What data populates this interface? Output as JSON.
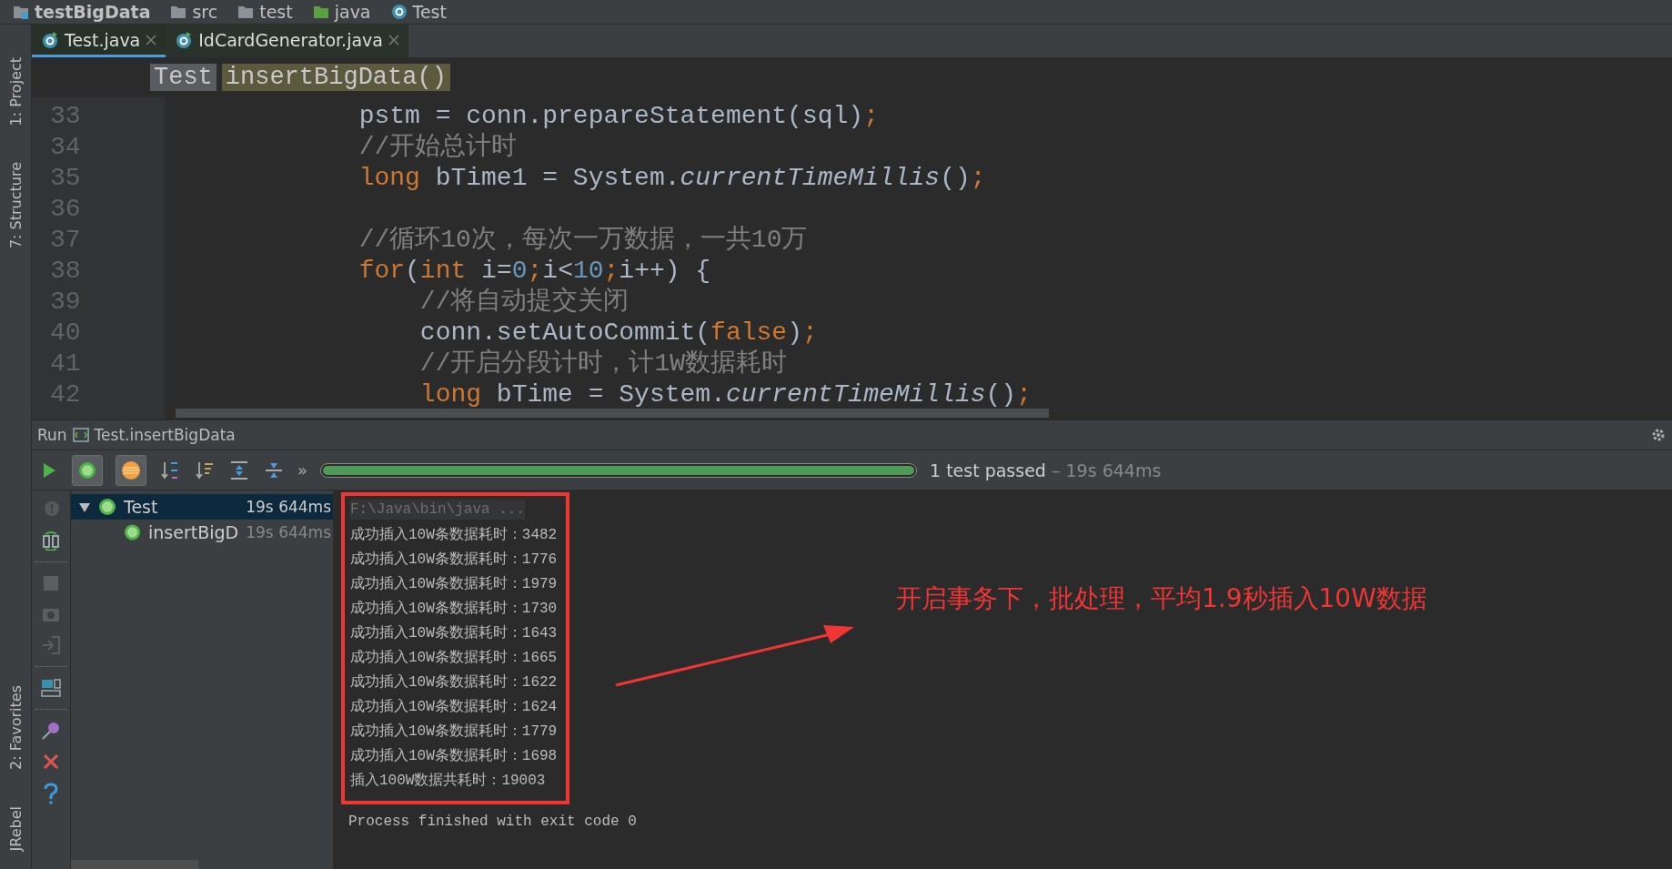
{
  "breadcrumbs": [
    {
      "label": "testBigData",
      "kind": "project"
    },
    {
      "label": "src",
      "kind": "folder"
    },
    {
      "label": "test",
      "kind": "folder"
    },
    {
      "label": "java",
      "kind": "source"
    },
    {
      "label": "Test",
      "kind": "class"
    }
  ],
  "side_tabs_top": [
    "1: Project",
    "7: Structure"
  ],
  "side_tabs_bottom": [
    "2: Favorites",
    "JRebel"
  ],
  "editor_tabs": [
    {
      "label": "Test.java",
      "selected": true
    },
    {
      "label": "IdCardGenerator.java",
      "selected": false
    }
  ],
  "editor_crumbs": [
    {
      "label": "Test",
      "kind": "class"
    },
    {
      "label": "insertBigData()",
      "kind": "method"
    }
  ],
  "code": [
    {
      "number": "33",
      "tokens": [
        {
          "kind": "plain",
          "text": "            pstm = conn.prepareStatement(sql)"
        },
        {
          "kind": "keyword",
          "text": ";"
        }
      ]
    },
    {
      "number": "34",
      "tokens": [
        {
          "kind": "comment",
          "text": "            //开始总计时"
        }
      ]
    },
    {
      "number": "35",
      "tokens": [
        {
          "kind": "keyword",
          "text": "            long"
        },
        {
          "kind": "plain",
          "text": " bTime1 = System."
        },
        {
          "kind": "italic",
          "text": "currentTimeMillis"
        },
        {
          "kind": "plain",
          "text": "()"
        },
        {
          "kind": "keyword",
          "text": ";"
        }
      ]
    },
    {
      "number": "36"
    },
    {
      "number": "37",
      "tokens": [
        {
          "kind": "comment",
          "text": "            //循环10次，每次一万数据，一共10万"
        }
      ]
    },
    {
      "number": "38",
      "tokens": [
        {
          "kind": "keyword",
          "text": "            for"
        },
        {
          "kind": "plain",
          "text": "("
        },
        {
          "kind": "keyword",
          "text": "int"
        },
        {
          "kind": "plain",
          "text": " i="
        },
        {
          "kind": "number",
          "text": "0"
        },
        {
          "kind": "keyword",
          "text": ";"
        },
        {
          "kind": "plain",
          "text": "i<"
        },
        {
          "kind": "number",
          "text": "10"
        },
        {
          "kind": "keyword",
          "text": ";"
        },
        {
          "kind": "plain",
          "text": "i++) {"
        }
      ]
    },
    {
      "number": "39",
      "tokens": [
        {
          "kind": "comment",
          "text": "                //将自动提交关闭"
        }
      ]
    },
    {
      "number": "40",
      "tokens": [
        {
          "kind": "plain",
          "text": "                conn.setAutoCommit("
        },
        {
          "kind": "keyword",
          "text": "false"
        },
        {
          "kind": "plain",
          "text": ")"
        },
        {
          "kind": "keyword",
          "text": ";"
        }
      ]
    },
    {
      "number": "41",
      "tokens": [
        {
          "kind": "comment",
          "text": "                //开启分段计时，计1W数据耗时"
        }
      ]
    },
    {
      "number": "42",
      "tokens": [
        {
          "kind": "keyword",
          "text": "                long"
        },
        {
          "kind": "plain",
          "text": " bTime = System."
        },
        {
          "kind": "italic",
          "text": "currentTimeMillis"
        },
        {
          "kind": "plain",
          "text": "()"
        },
        {
          "kind": "keyword",
          "text": ";"
        }
      ]
    }
  ],
  "run": {
    "label": "Run",
    "config": "Test.insertBigData",
    "status": "1 test passed",
    "duration": " – 19s 644ms",
    "level": 1,
    "more": "»"
  },
  "tree": [
    {
      "label": "Test",
      "time": "19s 644ms",
      "selected": true,
      "expanded": true,
      "children": [
        {
          "label": "insertBigD",
          "time": "19s 644ms",
          "selected": false
        }
      ]
    }
  ],
  "console": {
    "highlighted": true,
    "lines": [
      {
        "kind": "command",
        "text": "F:\\Java\\bin\\java ..."
      },
      {
        "kind": "output",
        "text": "成功插入10W条数据耗时：3482"
      },
      {
        "kind": "output",
        "text": "成功插入10W条数据耗时：1776"
      },
      {
        "kind": "output",
        "text": "成功插入10W条数据耗时：1979"
      },
      {
        "kind": "output",
        "text": "成功插入10W条数据耗时：1730"
      },
      {
        "kind": "output",
        "text": "成功插入10W条数据耗时：1643"
      },
      {
        "kind": "output",
        "text": "成功插入10W条数据耗时：1665"
      },
      {
        "kind": "output",
        "text": "成功插入10W条数据耗时：1622"
      },
      {
        "kind": "output",
        "text": "成功插入10W条数据耗时：1624"
      },
      {
        "kind": "output",
        "text": "成功插入10W条数据耗时：1779"
      },
      {
        "kind": "output",
        "text": "成功插入10W条数据耗时：1698"
      },
      {
        "kind": "output",
        "text": "插入100W数据共耗时：19003"
      }
    ],
    "exit": "Process finished with exit code 0"
  },
  "annotation": {
    "text": "开启事务下，批处理，平均1.9秒插入10W数据"
  }
}
